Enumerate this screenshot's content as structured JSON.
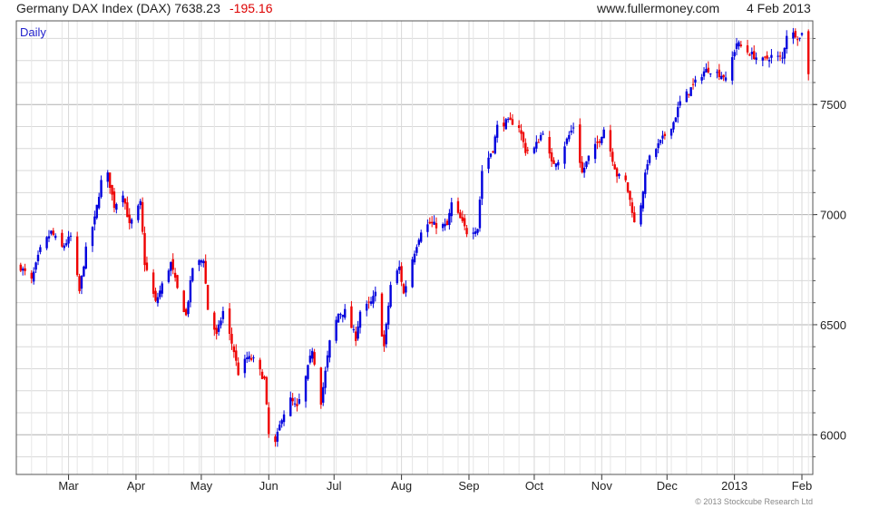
{
  "header": {
    "title": "Germany DAX Index (DAX) 7638.23",
    "change": "-195.16",
    "site": "www.fullermoney.com",
    "date": "4 Feb 2013"
  },
  "footer": {
    "copyright": "© 2013 Stockcube Research Ltd"
  },
  "colors": {
    "up": "#0000dd",
    "down": "#ee0000",
    "grid": "#d8d8d8",
    "major_grid": "#b0b0b0",
    "change": "#dd0000",
    "period": "#2222cc"
  },
  "chart_data": {
    "type": "candlestick",
    "period_label": "Daily",
    "x_tick_labels": [
      "Mar",
      "Apr",
      "May",
      "Jun",
      "Jul",
      "Aug",
      "Sep",
      "Oct",
      "Nov",
      "Dec",
      "2013",
      "Feb"
    ],
    "y_tick_labels": [
      "6000",
      "6500",
      "7000",
      "7500"
    ],
    "ylim": [
      5820,
      7880
    ],
    "xlim": [
      "2012-02-06",
      "2013-02-06"
    ],
    "grid": true,
    "y_axis_side": "right",
    "anchors": [
      [
        "2012-02-08",
        6760
      ],
      [
        "2012-02-13",
        6700
      ],
      [
        "2012-02-17",
        6840
      ],
      [
        "2012-02-22",
        6920
      ],
      [
        "2012-02-27",
        6850
      ],
      [
        "2012-03-02",
        6900
      ],
      [
        "2012-03-06",
        6650
      ],
      [
        "2012-03-09",
        6840
      ],
      [
        "2012-03-13",
        6980
      ],
      [
        "2012-03-16",
        7150
      ],
      [
        "2012-03-19",
        7180
      ],
      [
        "2012-03-22",
        7040
      ],
      [
        "2012-03-26",
        7100
      ],
      [
        "2012-03-29",
        6950
      ],
      [
        "2012-04-03",
        7050
      ],
      [
        "2012-04-05",
        6780
      ],
      [
        "2012-04-10",
        6600
      ],
      [
        "2012-04-13",
        6680
      ],
      [
        "2012-04-17",
        6780
      ],
      [
        "2012-04-20",
        6660
      ],
      [
        "2012-04-24",
        6540
      ],
      [
        "2012-04-27",
        6760
      ],
      [
        "2012-05-02",
        6800
      ],
      [
        "2012-05-04",
        6570
      ],
      [
        "2012-05-08",
        6450
      ],
      [
        "2012-05-11",
        6560
      ],
      [
        "2012-05-16",
        6380
      ],
      [
        "2012-05-18",
        6280
      ],
      [
        "2012-05-22",
        6350
      ],
      [
        "2012-05-25",
        6340
      ],
      [
        "2012-05-30",
        6250
      ],
      [
        "2012-06-01",
        6000
      ],
      [
        "2012-06-04",
        5960
      ],
      [
        "2012-06-07",
        6080
      ],
      [
        "2012-06-11",
        6160
      ],
      [
        "2012-06-14",
        6120
      ],
      [
        "2012-06-18",
        6260
      ],
      [
        "2012-06-21",
        6390
      ],
      [
        "2012-06-25",
        6150
      ],
      [
        "2012-06-29",
        6420
      ],
      [
        "2012-07-03",
        6550
      ],
      [
        "2012-07-06",
        6560
      ],
      [
        "2012-07-11",
        6440
      ],
      [
        "2012-07-13",
        6560
      ],
      [
        "2012-07-18",
        6600
      ],
      [
        "2012-07-20",
        6640
      ],
      [
        "2012-07-24",
        6400
      ],
      [
        "2012-07-27",
        6680
      ],
      [
        "2012-07-31",
        6760
      ],
      [
        "2012-08-02",
        6640
      ],
      [
        "2012-08-06",
        6800
      ],
      [
        "2012-08-10",
        6930
      ],
      [
        "2012-08-14",
        6960
      ],
      [
        "2012-08-17",
        6950
      ],
      [
        "2012-08-22",
        6950
      ],
      [
        "2012-08-24",
        7050
      ],
      [
        "2012-08-28",
        6980
      ],
      [
        "2012-08-31",
        6920
      ],
      [
        "2012-09-05",
        6940
      ],
      [
        "2012-09-07",
        7200
      ],
      [
        "2012-09-12",
        7300
      ],
      [
        "2012-09-14",
        7400
      ],
      [
        "2012-09-18",
        7420
      ],
      [
        "2012-09-21",
        7420
      ],
      [
        "2012-09-24",
        7400
      ],
      [
        "2012-09-27",
        7290
      ],
      [
        "2012-10-01",
        7300
      ],
      [
        "2012-10-05",
        7380
      ],
      [
        "2012-10-09",
        7230
      ],
      [
        "2012-10-12",
        7250
      ],
      [
        "2012-10-16",
        7340
      ],
      [
        "2012-10-19",
        7400
      ],
      [
        "2012-10-23",
        7190
      ],
      [
        "2012-10-26",
        7260
      ],
      [
        "2012-10-31",
        7340
      ],
      [
        "2012-11-02",
        7390
      ],
      [
        "2012-11-05",
        7290
      ],
      [
        "2012-11-08",
        7180
      ],
      [
        "2012-11-12",
        7150
      ],
      [
        "2012-11-15",
        7020
      ],
      [
        "2012-11-16",
        6960
      ],
      [
        "2012-11-19",
        7050
      ],
      [
        "2012-11-22",
        7240
      ],
      [
        "2012-11-26",
        7300
      ],
      [
        "2012-11-30",
        7360
      ],
      [
        "2012-12-04",
        7420
      ],
      [
        "2012-12-07",
        7510
      ],
      [
        "2012-12-11",
        7560
      ],
      [
        "2012-12-14",
        7600
      ],
      [
        "2012-12-18",
        7650
      ],
      [
        "2012-12-20",
        7660
      ],
      [
        "2012-12-27",
        7630
      ],
      [
        "2012-12-28",
        7610
      ],
      [
        "2013-01-02",
        7780
      ],
      [
        "2013-01-07",
        7740
      ],
      [
        "2013-01-10",
        7720
      ],
      [
        "2013-01-14",
        7700
      ],
      [
        "2013-01-18",
        7720
      ],
      [
        "2013-01-23",
        7710
      ],
      [
        "2013-01-25",
        7820
      ],
      [
        "2013-01-29",
        7820
      ],
      [
        "2013-01-31",
        7800
      ],
      [
        "2013-02-01",
        7833
      ],
      [
        "2013-02-04",
        7638
      ]
    ]
  }
}
